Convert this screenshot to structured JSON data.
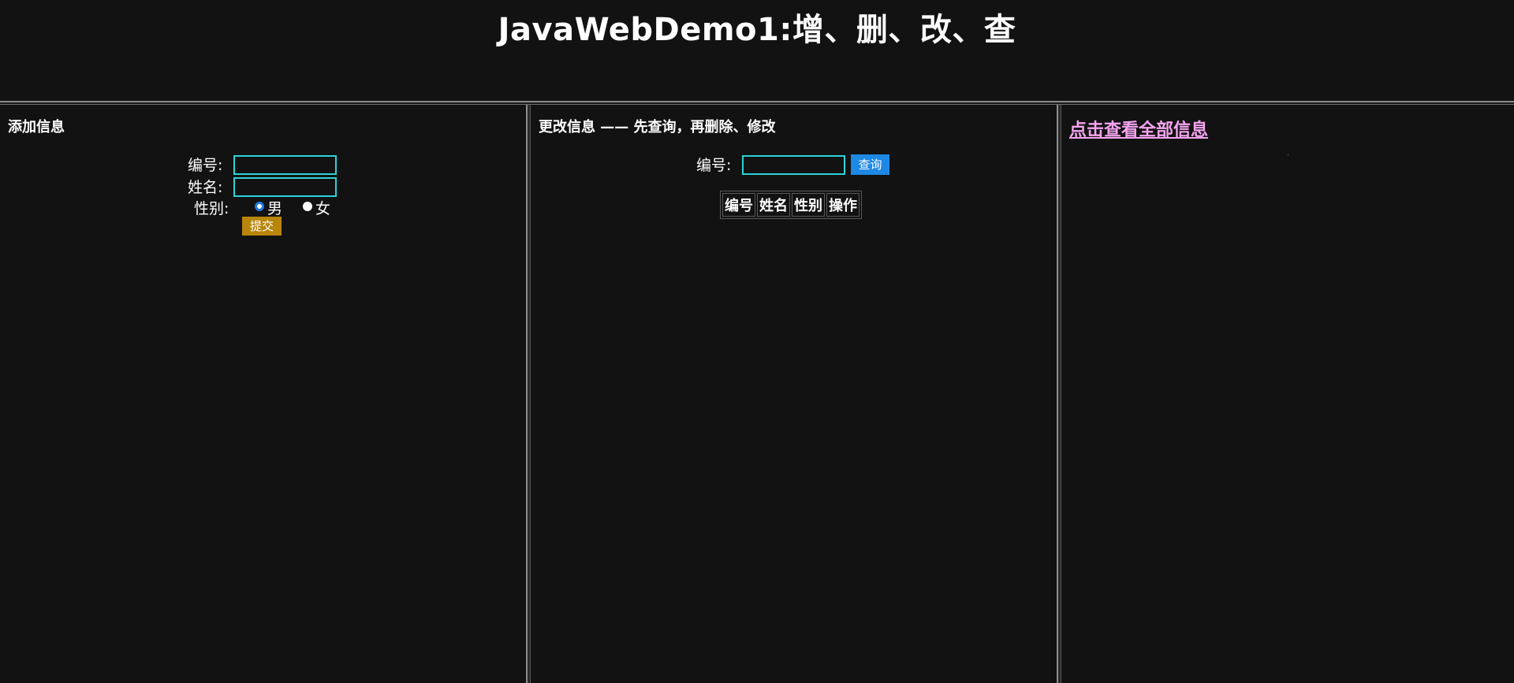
{
  "header": {
    "title": "JavaWebDemo1:增、删、改、查"
  },
  "add_panel": {
    "heading": "添加信息",
    "id_label": "编号:",
    "id_value": "",
    "name_label": "姓名:",
    "name_value": "",
    "gender_label": "性别:",
    "gender_options": [
      "男",
      "女"
    ],
    "gender_selected": "男",
    "submit_label": "提交"
  },
  "modify_panel": {
    "heading": "更改信息 —— 先查询，再删除、修改",
    "id_label": "编号:",
    "id_value": "",
    "query_label": "查询",
    "table_headers": [
      "编号",
      "姓名",
      "性别",
      "操作"
    ]
  },
  "view_panel": {
    "link_label": "点击查看全部信息"
  },
  "colors": {
    "background": "#121212",
    "input_border": "#2bd3d8",
    "submit_button": "#b8860b",
    "query_button": "#1e88e5",
    "link": "#f5a5f0"
  }
}
